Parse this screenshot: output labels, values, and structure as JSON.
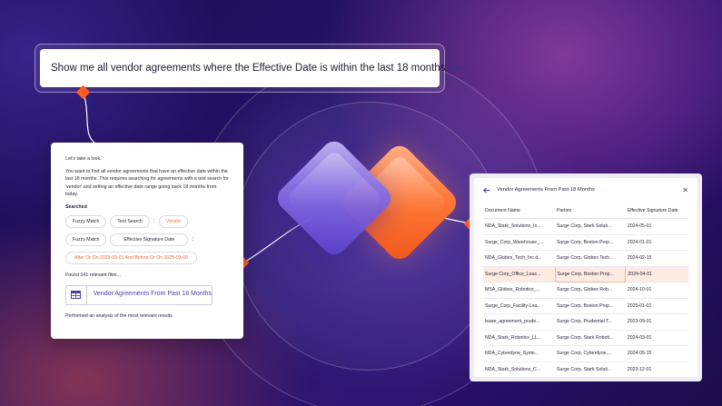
{
  "query": {
    "text": "Show me all vendor agreements where the Effective Date is within the last 18 months."
  },
  "chat": {
    "intro": "Let's take a look.",
    "explanation": "You want to find all vendor agreements that have an effective date within the last 18 months. This requires searching for agreements with a text search for 'vendor' and setting an effective date range going back 18 months from today.",
    "searched_label": "Searched",
    "row1": {
      "match": "Fuzzy Match",
      "field": "Text Search",
      "value": "Vendor"
    },
    "row2": {
      "match": "Fuzzy Match",
      "field": "Effective Signature Date"
    },
    "date_filter": "After Or On 2023-09-01 And Before Or On 2025-03-06",
    "found": "Found 141 relevant files...",
    "result_label": "Vendor Agreements From Past 18 Months",
    "footer": "Performed an analysis of the most relevant results."
  },
  "panel": {
    "title": "Vendor Agreements From Past 18 Months",
    "columns": [
      "Document Name",
      "Parties",
      "Effective Signature Date"
    ],
    "rows": [
      [
        "NDA_Stark_Solutions_In...",
        "Surge Corp, Stark Soluti...",
        "2024-05-01"
      ],
      [
        "Surge_Corp_Warehouse_...",
        "Surge Corp, Boston Prop...",
        "2024-01-01"
      ],
      [
        "NDA_Globex_Tech_Inc.d...",
        "Surge Corp, Globex Tech...",
        "2024-02-15"
      ],
      [
        "Surge Corp_Office_Leas...",
        "Surge Corp, Boston Prop...",
        "2024-04-01"
      ],
      [
        "MSA_Globex_Robotics_...",
        "Surge Corp, Globex Rob...",
        "2024-10-01"
      ],
      [
        "Surge_Corp_Facility-Lea...",
        "Surge Corp, Boston Prop...",
        "2025-01-01"
      ],
      [
        "lease_agreement_prude...",
        "Surge Corp, Prudential T...",
        "2023-09-01"
      ],
      [
        "NDA_Stark_Robotics_LL...",
        "Surge Corp, Stark Roboti...",
        "2024-03-01"
      ],
      [
        "NDA_Cyberdyne_Syste...",
        "Surge Corp, Cyberdyne,...",
        "2024-05-15"
      ],
      [
        "NDA_Stark_Solutions_C...",
        "Surge Corp, Stark Soluti...",
        "2023-12-01"
      ]
    ],
    "selected_row": 3
  },
  "colors": {
    "accent_orange": "#ff5a1f",
    "accent_purple": "#4a3fae",
    "selected_row": "#fdebe2"
  }
}
